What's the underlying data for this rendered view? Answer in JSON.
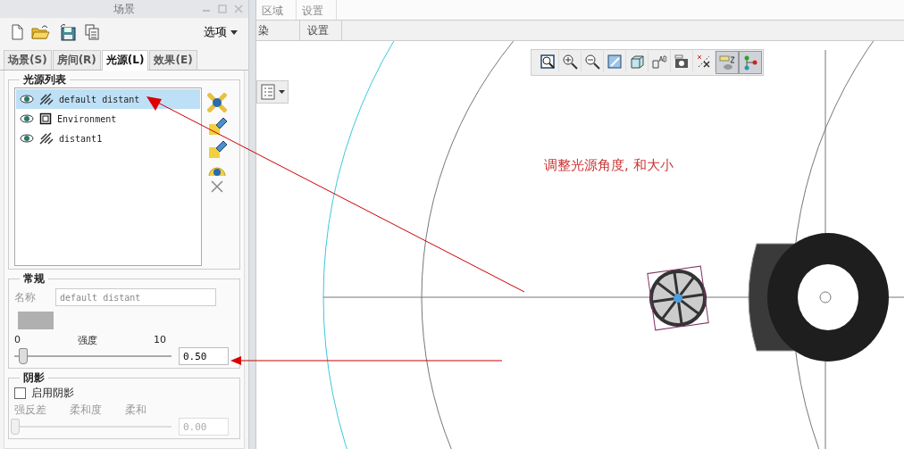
{
  "panel": {
    "title": "场景",
    "options_label": "选项"
  },
  "tabs": [
    {
      "label": "场景(S)",
      "selected": false
    },
    {
      "label": "房间(R)",
      "selected": false
    },
    {
      "label": "光源(L)",
      "selected": true
    },
    {
      "label": "效果(E)",
      "selected": false
    }
  ],
  "light_list": {
    "title": "光源列表",
    "items": [
      {
        "name": "default distant",
        "kind": "distant",
        "visible": true,
        "selected": true
      },
      {
        "name": "Environment",
        "kind": "environment",
        "visible": true,
        "selected": false
      },
      {
        "name": "distant1",
        "kind": "distant",
        "visible": true,
        "selected": false
      }
    ]
  },
  "general": {
    "title": "常规",
    "name_label": "名称",
    "name_value": "default distant",
    "min_label": "0",
    "intensity_label": "强度",
    "max_label": "10",
    "level": 0.05,
    "value": "0.50"
  },
  "shadow": {
    "title": "阴影",
    "enable_label": "启用阴影",
    "checked": false,
    "labels": [
      "强反差",
      "柔和度",
      "柔和"
    ],
    "level": 0,
    "value": "0.00"
  },
  "ribbon": {
    "top_labels": [
      "区域",
      "设置"
    ],
    "group_labels": [
      "染",
      "设置"
    ]
  },
  "view_toolbar": [
    {
      "kind": "zoom-window",
      "selected": false
    },
    {
      "kind": "zoom-in",
      "selected": false
    },
    {
      "kind": "zoom-out",
      "selected": false
    },
    {
      "kind": "repaint",
      "selected": false
    },
    {
      "kind": "view",
      "selected": false
    },
    {
      "kind": "annotation",
      "selected": false
    },
    {
      "kind": "camera",
      "selected": false
    },
    {
      "kind": "datum",
      "selected": false
    },
    {
      "kind": "display",
      "selected": true
    },
    {
      "kind": "graph",
      "selected": true
    }
  ],
  "viewport": {
    "annotation": "调整光源角度, 和大小"
  }
}
